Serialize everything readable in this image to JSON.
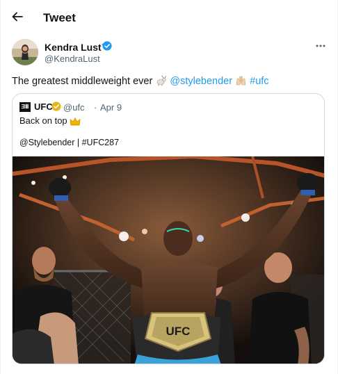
{
  "header": {
    "title": "Tweet",
    "back_icon": "arrow-left-icon"
  },
  "author": {
    "name": "Kendra Lust™",
    "handle": "@KendraLust",
    "verified": true,
    "verified_color": "#1d9bf0"
  },
  "tweet": {
    "text_lead": "The greatest middleweight ever",
    "mention": "@stylebender",
    "hashtag": "#ufc",
    "link_color": "#1d9bf0"
  },
  "quote": {
    "logo_text": "ƎⅢ",
    "name": "UFC",
    "handle": "@ufc",
    "separator": "·",
    "date": "Apr 9",
    "line1": "Back on top",
    "line2": "@Stylebender | #UFC287",
    "badge_color": "#e2b719"
  },
  "photo": {
    "belt_text": "UFC"
  }
}
